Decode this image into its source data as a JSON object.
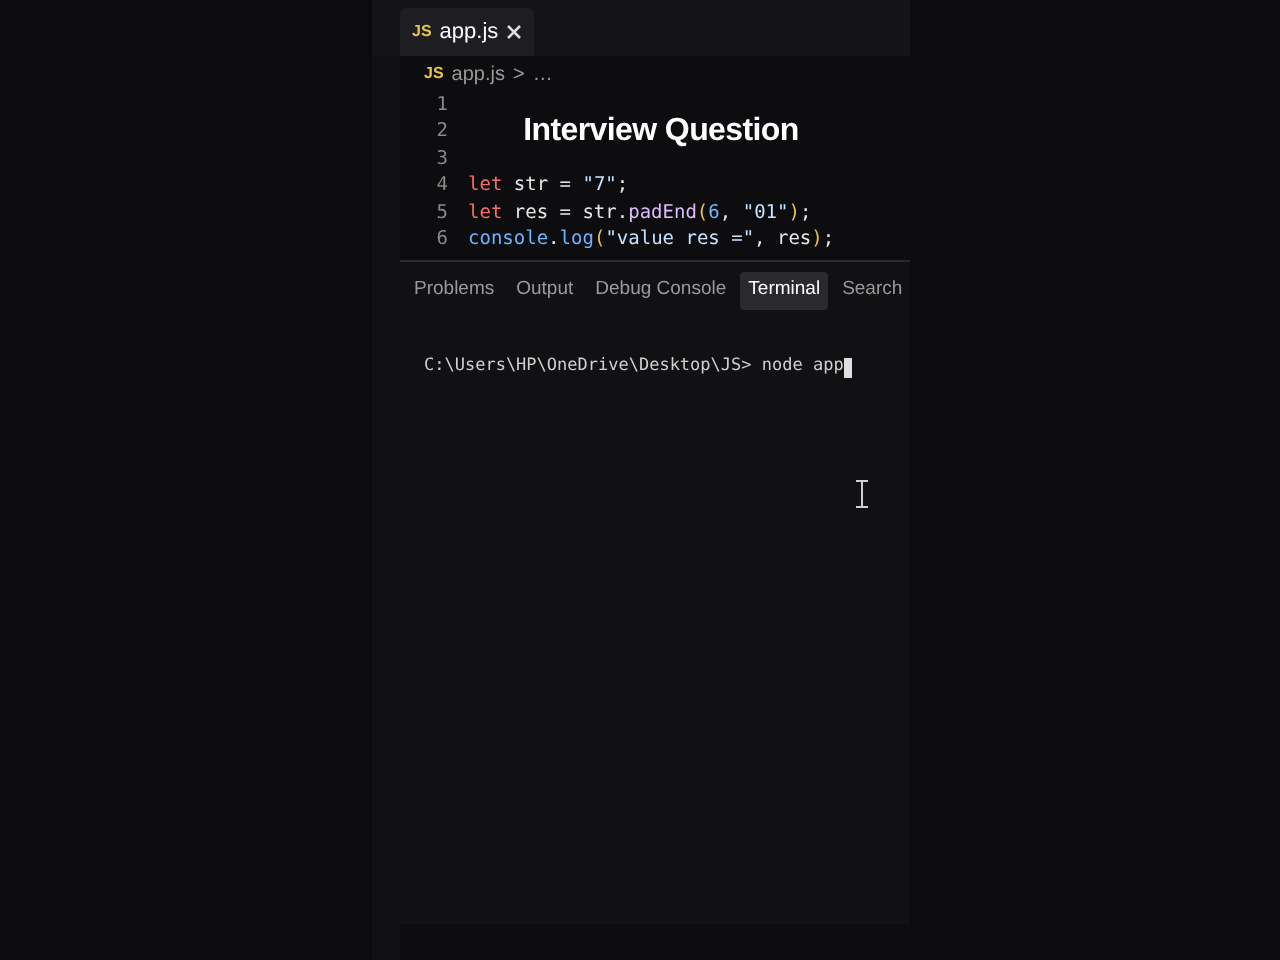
{
  "editor_tab": {
    "icon_text": "JS",
    "label": "app.js"
  },
  "breadcrumb": {
    "icon_text": "JS",
    "file": "app.js",
    "separator": ">",
    "more": "…"
  },
  "overlay_title": "Interview Question",
  "code_lines": [
    {
      "number": "1"
    },
    {
      "number": "2"
    },
    {
      "number": "3"
    },
    {
      "number": "4",
      "tokens": [
        {
          "text": "let",
          "kind": "keyword"
        },
        {
          "text": " str = ",
          "kind": "plain"
        },
        {
          "text": "\"7\"",
          "kind": "string"
        },
        {
          "text": ";",
          "kind": "plain"
        }
      ]
    },
    {
      "number": "5",
      "tokens": [
        {
          "text": "let",
          "kind": "keyword"
        },
        {
          "text": " res = str.",
          "kind": "plain"
        },
        {
          "text": "padEnd",
          "kind": "method"
        },
        {
          "text": "(",
          "kind": "bracket"
        },
        {
          "text": "6",
          "kind": "number"
        },
        {
          "text": ", ",
          "kind": "plain"
        },
        {
          "text": "\"01\"",
          "kind": "string"
        },
        {
          "text": ")",
          "kind": "bracket"
        },
        {
          "text": ";",
          "kind": "plain"
        }
      ]
    },
    {
      "number": "6",
      "tokens": [
        {
          "text": "console",
          "kind": "object"
        },
        {
          "text": ".",
          "kind": "plain"
        },
        {
          "text": "log",
          "kind": "object"
        },
        {
          "text": "(",
          "kind": "bracket"
        },
        {
          "text": "\"value res =\"",
          "kind": "string"
        },
        {
          "text": ", res",
          "kind": "plain"
        },
        {
          "text": ")",
          "kind": "bracket"
        },
        {
          "text": ";",
          "kind": "plain"
        }
      ]
    }
  ],
  "panel_tabs": [
    {
      "label": "Problems",
      "selected": false
    },
    {
      "label": "Output",
      "selected": false
    },
    {
      "label": "Debug Console",
      "selected": false
    },
    {
      "label": "Terminal",
      "selected": true
    },
    {
      "label": "Search",
      "selected": false
    }
  ],
  "terminal": {
    "prompt": "C:\\Users\\HP\\OneDrive\\Desktop\\JS>",
    "command": "node app"
  }
}
